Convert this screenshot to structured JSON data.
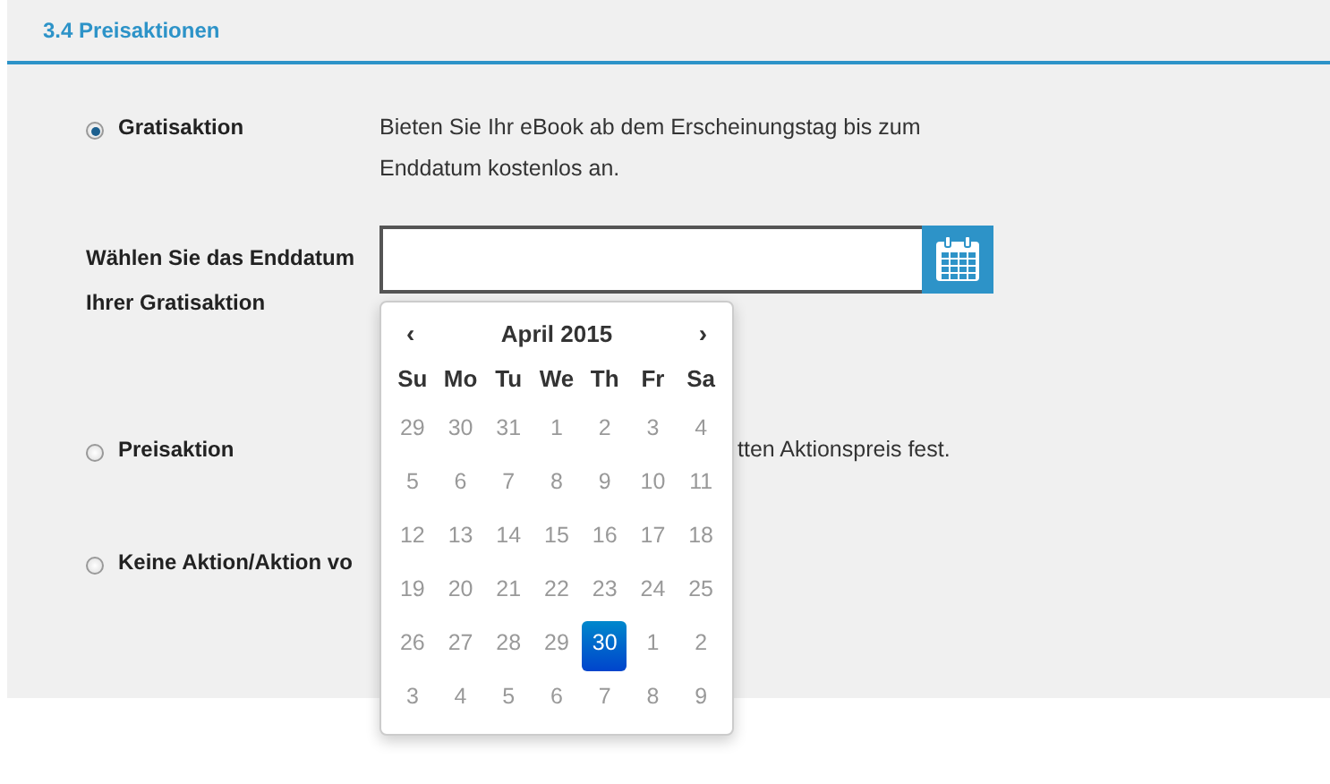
{
  "section_title": "3.4 Preisaktionen",
  "options": [
    {
      "kind": "free",
      "label": "Gratisaktion",
      "selected": true,
      "description": "Bieten Sie Ihr eBook ab dem Erscheinungstag bis zum Enddatum kostenlos an."
    },
    {
      "kind": "date",
      "label": "Wählen Sie das Enddatum Ihrer Gratisaktion"
    },
    {
      "kind": "price",
      "label": "Preisaktion",
      "selected": false,
      "description": "tten Aktionspreis fest."
    },
    {
      "kind": "none",
      "label": "Keine Aktion/Aktion vo",
      "selected": false
    }
  ],
  "datepicker": {
    "prev": "‹",
    "title": "April 2015",
    "next": "›",
    "weekdays": [
      "Su",
      "Mo",
      "Tu",
      "We",
      "Th",
      "Fr",
      "Sa"
    ],
    "weeks": [
      [
        {
          "day": "29",
          "selected": false
        },
        {
          "day": "30",
          "selected": false
        },
        {
          "day": "31",
          "selected": false
        },
        {
          "day": "1",
          "selected": false
        },
        {
          "day": "2",
          "selected": false
        },
        {
          "day": "3",
          "selected": false
        },
        {
          "day": "4",
          "selected": false
        }
      ],
      [
        {
          "day": "5",
          "selected": false
        },
        {
          "day": "6",
          "selected": false
        },
        {
          "day": "7",
          "selected": false
        },
        {
          "day": "8",
          "selected": false
        },
        {
          "day": "9",
          "selected": false
        },
        {
          "day": "10",
          "selected": false
        },
        {
          "day": "11",
          "selected": false
        }
      ],
      [
        {
          "day": "12",
          "selected": false
        },
        {
          "day": "13",
          "selected": false
        },
        {
          "day": "14",
          "selected": false
        },
        {
          "day": "15",
          "selected": false
        },
        {
          "day": "16",
          "selected": false
        },
        {
          "day": "17",
          "selected": false
        },
        {
          "day": "18",
          "selected": false
        }
      ],
      [
        {
          "day": "19",
          "selected": false
        },
        {
          "day": "20",
          "selected": false
        },
        {
          "day": "21",
          "selected": false
        },
        {
          "day": "22",
          "selected": false
        },
        {
          "day": "23",
          "selected": false
        },
        {
          "day": "24",
          "selected": false
        },
        {
          "day": "25",
          "selected": false
        }
      ],
      [
        {
          "day": "26",
          "selected": false
        },
        {
          "day": "27",
          "selected": false
        },
        {
          "day": "28",
          "selected": false
        },
        {
          "day": "29",
          "selected": false
        },
        {
          "day": "30",
          "selected": true
        },
        {
          "day": "1",
          "selected": false
        },
        {
          "day": "2",
          "selected": false
        }
      ],
      [
        {
          "day": "3",
          "selected": false
        },
        {
          "day": "4",
          "selected": false
        },
        {
          "day": "5",
          "selected": false
        },
        {
          "day": "6",
          "selected": false
        },
        {
          "day": "7",
          "selected": false
        },
        {
          "day": "8",
          "selected": false
        },
        {
          "day": "9",
          "selected": false
        }
      ]
    ]
  }
}
